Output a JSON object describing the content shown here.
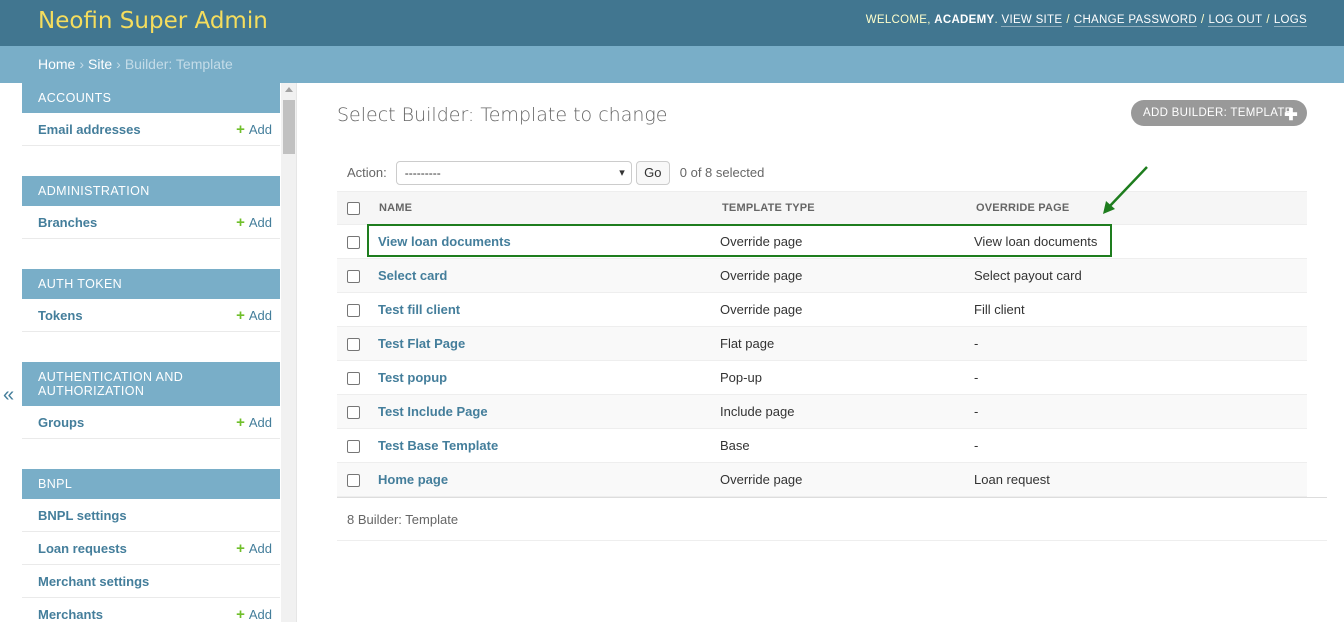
{
  "header": {
    "brand": "Neofin Super Admin",
    "welcome": "Welcome,",
    "username": "ACADEMY",
    "links": [
      "View site",
      "Change password",
      "Log out",
      "Logs"
    ]
  },
  "breadcrumbs": {
    "home": "Home",
    "site": "Site",
    "current": "Builder: Template",
    "separator": "›"
  },
  "sidebar": {
    "collapse_glyph": "«",
    "add_label": "Add",
    "modules": [
      {
        "caption": "Accounts",
        "items": [
          {
            "label": "Email addresses",
            "add": true
          }
        ]
      },
      {
        "caption": "Administration",
        "items": [
          {
            "label": "Branches",
            "add": true
          }
        ]
      },
      {
        "caption": "Auth Token",
        "items": [
          {
            "label": "Tokens",
            "add": true
          }
        ]
      },
      {
        "caption": "Authentication and Authorization",
        "items": [
          {
            "label": "Groups",
            "add": true
          }
        ]
      },
      {
        "caption": "BNPL",
        "items": [
          {
            "label": "BNPL settings",
            "add": false
          },
          {
            "label": "Loan requests",
            "add": true
          },
          {
            "label": "Merchant settings",
            "add": false
          },
          {
            "label": "Merchants",
            "add": true
          }
        ]
      }
    ]
  },
  "content": {
    "title": "Select Builder: Template to change",
    "add_button": "Add Builder: Template",
    "action_label": "Action:",
    "action_selected": "---------",
    "go_label": "Go",
    "counter": "0 of 8 selected",
    "columns": [
      "Name",
      "Template type",
      "Override page"
    ],
    "rows": [
      {
        "name": "View loan documents",
        "type": "Override page",
        "override": "View loan documents"
      },
      {
        "name": "Select card",
        "type": "Override page",
        "override": "Select payout card"
      },
      {
        "name": "Test fill client",
        "type": "Override page",
        "override": "Fill client"
      },
      {
        "name": "Test Flat Page",
        "type": "Flat page",
        "override": "-"
      },
      {
        "name": "Test popup",
        "type": "Pop-up",
        "override": "-"
      },
      {
        "name": "Test Include Page",
        "type": "Include page",
        "override": "-"
      },
      {
        "name": "Test Base Template",
        "type": "Base",
        "override": "-"
      },
      {
        "name": "Home page",
        "type": "Override page",
        "override": "Loan request"
      }
    ],
    "paginator": "8 Builder: Template"
  },
  "annotation": {
    "color": "#1e7d1e"
  },
  "colors": {
    "header_bg": "#417690",
    "brand_yellow": "#f5dd5d",
    "breadcrumb_bg": "#79aec8",
    "link": "#447e9b",
    "add_green": "#70bf2b"
  }
}
